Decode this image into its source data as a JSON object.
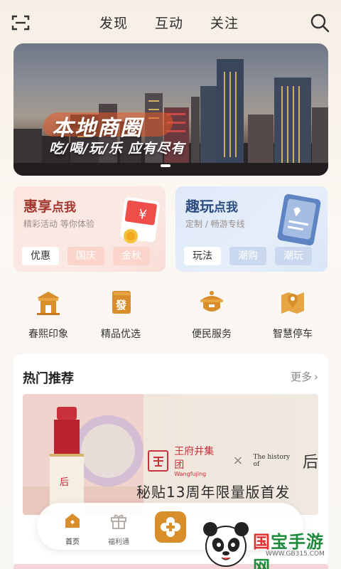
{
  "nav": {
    "tabs": [
      "发现",
      "互动",
      "关注"
    ]
  },
  "banner": {
    "title": "本地商圈",
    "subtitle": "吃/喝/玩/乐 应有尽有"
  },
  "promo_left": {
    "title": "惠享",
    "title_small": "点我",
    "subtitle": "精彩活动 等你体验",
    "tags": [
      "优惠",
      "国庆",
      "金秋"
    ]
  },
  "promo_right": {
    "title": "趣玩",
    "title_small": "点我",
    "subtitle": "定制 / 畅游专线",
    "tags": [
      "玩法",
      "潮购",
      "潮玩"
    ]
  },
  "quick": [
    {
      "label": "春熙印象",
      "icon": "pavilion-icon"
    },
    {
      "label": "精品优选",
      "icon": "goods-icon"
    },
    {
      "label": "便民服务",
      "icon": "service-icon"
    },
    {
      "label": "智慧停车",
      "icon": "parking-icon"
    }
  ],
  "hot": {
    "title": "热门推荐",
    "more": "更多",
    "feature": {
      "brand": "王府井集团",
      "brand_en": "Wangfujing",
      "partner": "The history of",
      "caption": "秘贴13周年限量版首发"
    }
  },
  "tabbar": {
    "items": [
      "首页",
      "福利通"
    ]
  },
  "watermark": {
    "text_a": "国",
    "text_b": "宝手游网",
    "url": "WWW.GB315.COM"
  },
  "colors": {
    "accent": "#d88e2b",
    "promo_red": "#a2352c",
    "promo_blue": "#2d4d80"
  }
}
